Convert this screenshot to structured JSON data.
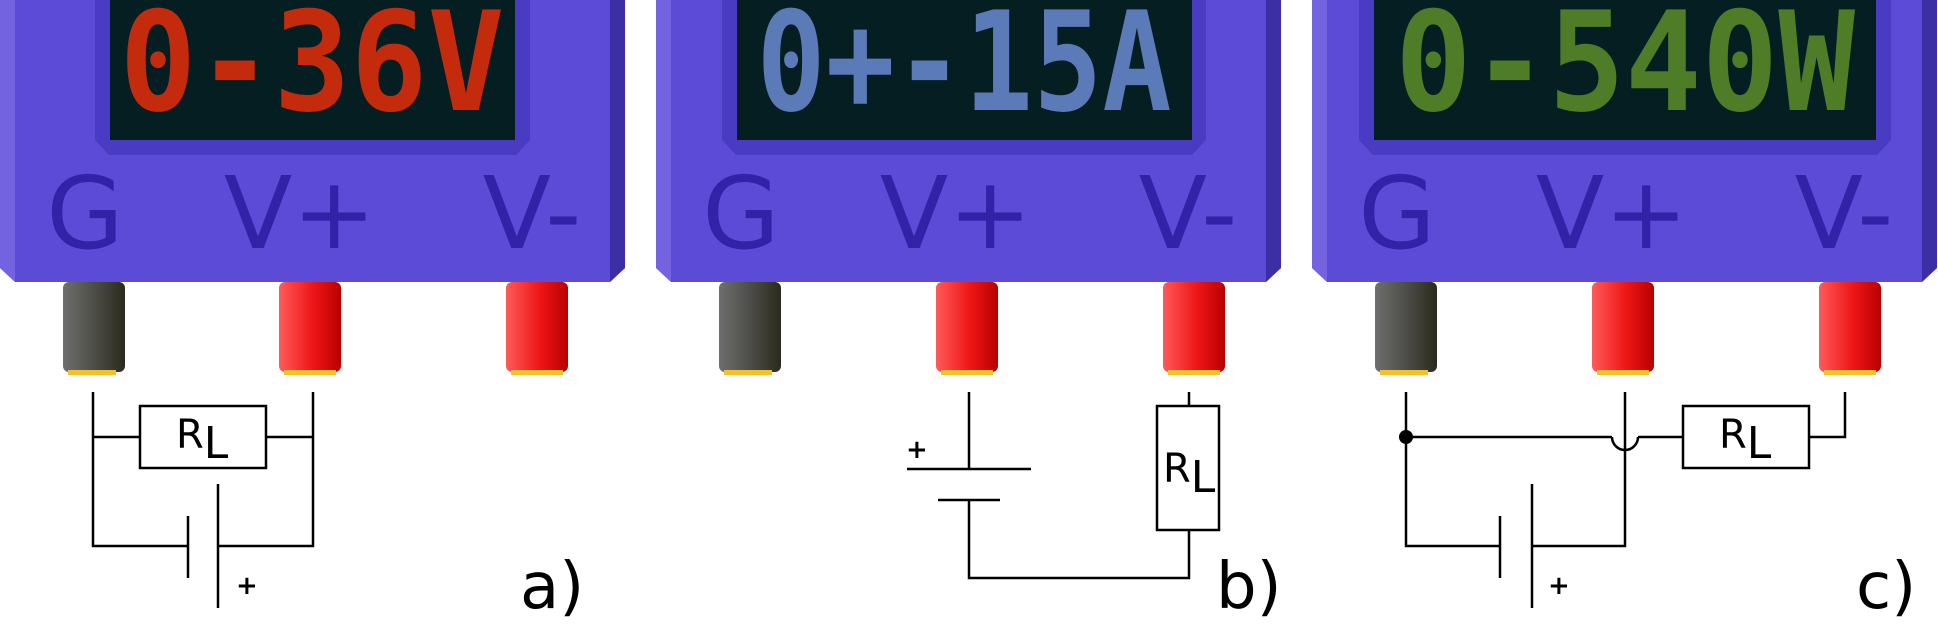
{
  "colors": {
    "body": "#5b4bd6",
    "body_light": "#7463e0",
    "body_dark": "#3c2fa3",
    "bezel": "#4a3cc2",
    "screen": "#051e22",
    "terminal_text": "#3122a8",
    "probe_black": "#2a2a22",
    "probe_red": "#ee1111",
    "probe_tip": "#f2c12e",
    "wire": "#000000"
  },
  "panels": [
    {
      "display": "0-36V",
      "display_color": "#c42a0c",
      "terminals": [
        "G",
        "V+",
        "V-"
      ],
      "resistor": "R",
      "resistor_sub": "L",
      "plus": "+",
      "caption": "a)"
    },
    {
      "display": "0+-15A",
      "display_color": "#5a7ab8",
      "terminals": [
        "G",
        "V+",
        "V-"
      ],
      "resistor": "R",
      "resistor_sub": "L",
      "plus": "+",
      "caption": "b)"
    },
    {
      "display": "0-540W",
      "display_color": "#4f7c26",
      "terminals": [
        "G",
        "V+",
        "V-"
      ],
      "resistor": "R",
      "resistor_sub": "L",
      "plus": "+",
      "caption": "c)"
    }
  ]
}
